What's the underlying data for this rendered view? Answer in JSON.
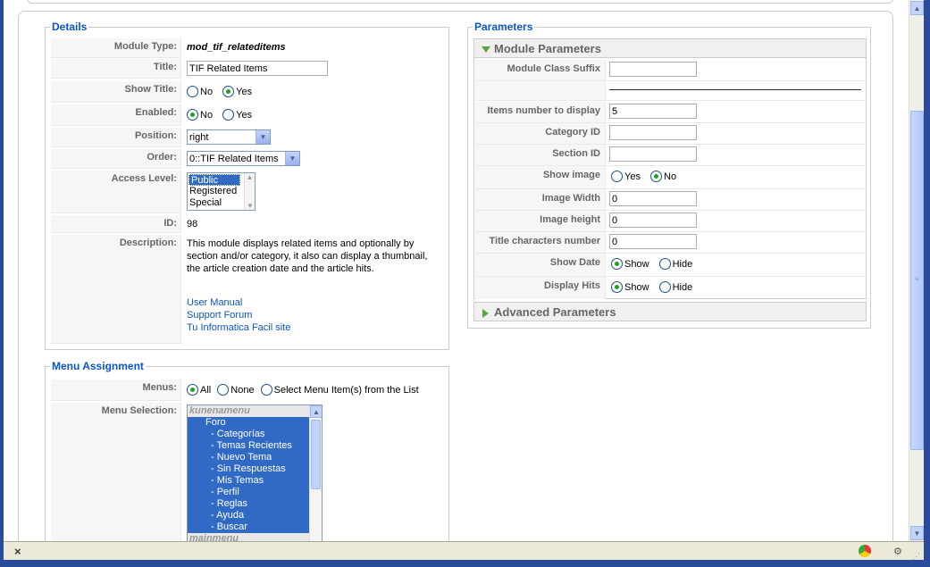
{
  "details": {
    "legend": "Details",
    "module_type_label": "Module Type:",
    "module_type_value": "mod_tif_relateditems",
    "title_label": "Title:",
    "title_value": "TIF Related Items",
    "show_title_label": "Show Title:",
    "show_title_options": [
      "No",
      "Yes"
    ],
    "show_title_selected": "Yes",
    "enabled_label": "Enabled:",
    "enabled_options": [
      "No",
      "Yes"
    ],
    "enabled_selected": "No",
    "position_label": "Position:",
    "position_value": "right",
    "order_label": "Order:",
    "order_value": "0::TIF Related Items",
    "access_label": "Access Level:",
    "access_options": [
      "Public",
      "Registered",
      "Special"
    ],
    "access_selected": "Public",
    "id_label": "ID:",
    "id_value": "98",
    "description_label": "Description:",
    "description_text": "This module displays related items and optionally by section and/or category, it also can display a thumbnail, the article creation date and the article hits.",
    "links": [
      "User Manual",
      "Support Forum",
      "Tu Informatica Facil site"
    ]
  },
  "menu": {
    "legend": "Menu Assignment",
    "menus_label": "Menus:",
    "menus_options": [
      "All",
      "None",
      "Select Menu Item(s) from the List"
    ],
    "menus_selected": "All",
    "selection_label": "Menu Selection:",
    "selection_items": [
      "kunenamenu",
      "Foro",
      "- Categorías",
      "- Temas Recientes",
      "- Nuevo Tema",
      "- Sin Respuestas",
      "- Mis Temas",
      "- Perfil",
      "- Reglas",
      "- Ayuda",
      "- Buscar",
      "mainmenu"
    ]
  },
  "params": {
    "legend": "Parameters",
    "module_params_title": "Module Parameters",
    "advanced_params_title": "Advanced Parameters",
    "class_suffix_label": "Module Class Suffix",
    "class_suffix_value": "",
    "items_number_label": "Items number to display",
    "items_number_value": "5",
    "category_label": "Category ID",
    "category_value": "",
    "section_label": "Section ID",
    "section_value": "",
    "show_image_label": "Show image",
    "show_image_options": [
      "Yes",
      "No"
    ],
    "show_image_selected": "No",
    "image_width_label": "Image Width",
    "image_width_value": "0",
    "image_height_label": "Image height",
    "image_height_value": "0",
    "title_chars_label": "Title characters number",
    "title_chars_value": "0",
    "show_date_label": "Show Date",
    "show_date_options": [
      "Show",
      "Hide"
    ],
    "show_date_selected": "Show",
    "display_hits_label": "Display Hits",
    "display_hits_options": [
      "Show",
      "Hide"
    ],
    "display_hits_selected": "Show"
  },
  "statusbar": {
    "close_glyph": "×"
  },
  "colors": {
    "legend_blue": "#0b55c4",
    "selection_blue": "#316ac5",
    "radio_green": "#21a121"
  }
}
